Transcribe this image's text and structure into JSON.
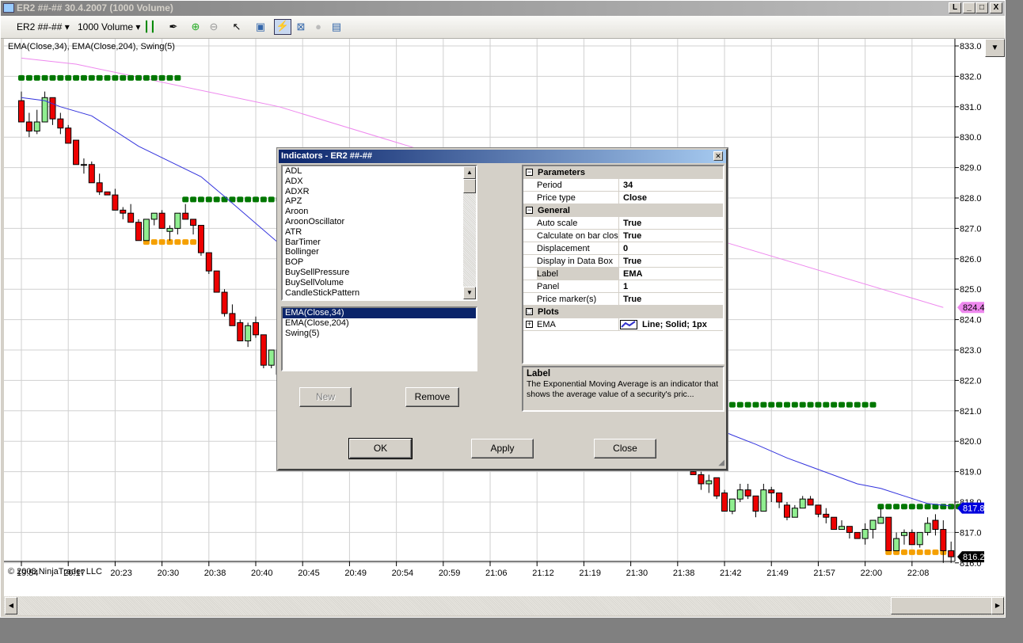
{
  "window": {
    "title": "ER2 ##-##  30.4.2007 (1000 Volume)",
    "buttons": [
      "L",
      "_",
      "□",
      "X"
    ]
  },
  "toolbar": {
    "instrument": "ER2 ##-##",
    "interval": "1000 Volume",
    "icons": [
      "bar-style-icon",
      "draw-pen-icon",
      "zoom-in-icon",
      "zoom-out-icon",
      "cursor-icon",
      "data-box-icon",
      "indicators-icon",
      "strategies-icon",
      "properties-icon",
      "table-icon"
    ]
  },
  "chart": {
    "indicator_label": "EMA(Close,34), EMA(Close,204), Swing(5)",
    "copyright": "© 2008 NinjaTrader  LLC",
    "colors": {
      "up": "#90ee90",
      "down": "#ee0000",
      "ema34": "#3333dd",
      "ema204": "#ee88ee",
      "swing_high": "#007700",
      "swing_low": "#f5a000"
    },
    "price_labels": [
      "833.0",
      "832.0",
      "831.0",
      "830.0",
      "829.0",
      "828.0",
      "827.0",
      "826.0",
      "825.0",
      "824.0",
      "823.0",
      "822.0",
      "821.0",
      "820.0",
      "819.0",
      "818.0",
      "817.0",
      "816.0"
    ],
    "ylim": [
      816,
      833
    ],
    "time_labels": [
      "19:54",
      "20:17",
      "20:23",
      "20:30",
      "20:38",
      "20:40",
      "20:45",
      "20:49",
      "20:54",
      "20:59",
      "21:06",
      "21:12",
      "21:19",
      "21:30",
      "21:38",
      "21:42",
      "21:49",
      "21:57",
      "22:00",
      "22:08"
    ],
    "bars_per_tick": 6,
    "candle_segments": [
      {
        "start": 0,
        "ohlc": [
          [
            831.2,
            831.5,
            830.5,
            830.5
          ],
          [
            830.5,
            830.8,
            830.0,
            830.2
          ],
          [
            830.2,
            830.9,
            830.1,
            830.5
          ],
          [
            830.5,
            831.5,
            830.5,
            831.3
          ],
          [
            831.3,
            831.3,
            830.4,
            830.6
          ],
          [
            830.6,
            830.8,
            830.1,
            830.3
          ],
          [
            830.3,
            830.4,
            829.8,
            829.8
          ],
          [
            829.9,
            829.9,
            829.1,
            829.1
          ],
          [
            829.1,
            829.3,
            828.8,
            829.1
          ],
          [
            829.1,
            829.2,
            828.5,
            828.5
          ],
          [
            828.5,
            828.8,
            828.1,
            828.2
          ],
          [
            828.2,
            828.2,
            828.1,
            828.1
          ],
          [
            828.1,
            828.3,
            827.6,
            827.6
          ],
          [
            827.6,
            827.7,
            827.3,
            827.5
          ],
          [
            827.5,
            827.8,
            827.2,
            827.2
          ],
          [
            827.2,
            827.3,
            826.6,
            826.6
          ],
          [
            826.6,
            827.3,
            826.6,
            827.3
          ],
          [
            827.3,
            827.5,
            827.1,
            827.5
          ],
          [
            827.5,
            827.6,
            827.0,
            827.0
          ],
          [
            826.9,
            827.1,
            826.6,
            827.0
          ],
          [
            827.0,
            827.5,
            826.8,
            827.5
          ],
          [
            827.5,
            827.8,
            827.3,
            827.3
          ],
          [
            827.3,
            827.3,
            826.8,
            827.1
          ],
          [
            827.1,
            827.1,
            826.1,
            826.2
          ],
          [
            826.2,
            826.2,
            825.5,
            825.6
          ],
          [
            825.6,
            825.6,
            824.9,
            824.9
          ],
          [
            824.9,
            825.0,
            824.1,
            824.2
          ],
          [
            824.2,
            824.5,
            823.8,
            823.8
          ],
          [
            823.9,
            824.0,
            823.3,
            823.3
          ],
          [
            823.3,
            823.9,
            823.1,
            823.8
          ],
          [
            823.9,
            824.1,
            823.4,
            823.5
          ],
          [
            823.5,
            823.5,
            822.4,
            822.5
          ],
          [
            822.5,
            823.0,
            822.4,
            823.0
          ],
          [
            823.0,
            823.0,
            822.2,
            822.2
          ]
        ]
      },
      {
        "start": 86,
        "ohlc": [
          [
            819.0,
            819.1,
            818.9,
            818.9
          ],
          [
            818.9,
            819.0,
            818.4,
            818.6
          ],
          [
            818.6,
            818.9,
            818.3,
            818.7
          ],
          [
            818.8,
            818.8,
            818.1,
            818.2
          ],
          [
            818.3,
            818.4,
            817.7,
            817.7
          ],
          [
            817.7,
            818.1,
            817.6,
            818.1
          ],
          [
            818.1,
            818.6,
            818.0,
            818.4
          ],
          [
            818.4,
            818.6,
            818.1,
            818.2
          ],
          [
            818.2,
            818.2,
            817.5,
            817.7
          ],
          [
            817.7,
            818.6,
            817.7,
            818.4
          ],
          [
            818.4,
            818.5,
            818.0,
            818.3
          ],
          [
            818.3,
            818.3,
            817.8,
            818.0
          ],
          [
            817.9,
            818.0,
            817.4,
            817.5
          ],
          [
            817.5,
            817.9,
            817.5,
            817.8
          ],
          [
            817.8,
            818.2,
            817.8,
            818.1
          ],
          [
            818.1,
            818.2,
            817.9,
            817.9
          ],
          [
            817.9,
            817.9,
            817.5,
            817.6
          ],
          [
            817.6,
            817.8,
            817.3,
            817.5
          ],
          [
            817.5,
            817.5,
            817.1,
            817.1
          ],
          [
            817.1,
            817.4,
            817.1,
            817.2
          ],
          [
            817.2,
            817.2,
            816.8,
            817.0
          ],
          [
            817.0,
            817.0,
            816.8,
            816.8
          ],
          [
            816.8,
            817.3,
            816.6,
            817.1
          ],
          [
            817.1,
            817.4,
            816.8,
            817.4
          ],
          [
            817.3,
            817.8,
            817.3,
            817.5
          ],
          [
            817.5,
            817.5,
            816.4,
            816.4
          ],
          [
            816.4,
            817.0,
            816.4,
            816.8
          ],
          [
            816.9,
            817.1,
            816.6,
            817.0
          ],
          [
            817.0,
            817.1,
            816.6,
            816.6
          ],
          [
            816.6,
            817.0,
            816.5,
            817.0
          ],
          [
            817.0,
            817.5,
            816.9,
            817.3
          ],
          [
            817.4,
            817.6,
            816.9,
            817.1
          ],
          [
            817.1,
            817.4,
            816.0,
            816.4
          ],
          [
            816.4,
            816.7,
            816.0,
            816.2
          ]
        ]
      }
    ],
    "ema34": [
      [
        0,
        831.3
      ],
      [
        3,
        831.2
      ],
      [
        5,
        831.0
      ],
      [
        9,
        830.7
      ],
      [
        15,
        829.7
      ],
      [
        19,
        829.2
      ],
      [
        23,
        828.7
      ],
      [
        26,
        828.05
      ],
      [
        33,
        826.5
      ],
      [
        91,
        820.2
      ],
      [
        94,
        819.9
      ],
      [
        98,
        819.45
      ],
      [
        107,
        818.6
      ],
      [
        110,
        818.45
      ],
      [
        116,
        817.95
      ],
      [
        119,
        817.87
      ]
    ],
    "ema204": [
      [
        0,
        832.6
      ],
      [
        7,
        832.4
      ],
      [
        33,
        831.0
      ],
      [
        90,
        826.55
      ],
      [
        118,
        824.4
      ]
    ],
    "swings": [
      {
        "kind": "high",
        "price": 831.95,
        "from": 0,
        "to": 20
      },
      {
        "kind": "high",
        "price": 827.95,
        "from": 21,
        "to": 33
      },
      {
        "kind": "high",
        "price": 821.2,
        "from": 90,
        "to": 109
      },
      {
        "kind": "high",
        "price": 817.85,
        "from": 110,
        "to": 120
      },
      {
        "kind": "low",
        "price": 826.55,
        "from": 16,
        "to": 22
      },
      {
        "kind": "low",
        "price": 816.35,
        "from": 111,
        "to": 118
      }
    ],
    "markers": [
      {
        "label": "824.4",
        "price": 824.4,
        "bg": "#ee88ee",
        "fg": "#000"
      },
      {
        "label": "817.8",
        "price": 817.8,
        "bg": "#0000dd",
        "fg": "#fff"
      },
      {
        "label": "816.2",
        "price": 816.2,
        "bg": "#000",
        "fg": "#fff"
      }
    ]
  },
  "dialog": {
    "title": "Indicators - ER2 ##-##",
    "available": [
      "ADL",
      "ADX",
      "ADXR",
      "APZ",
      "Aroon",
      "AroonOscillator",
      "ATR",
      "BarTimer",
      "Bollinger",
      "BOP",
      "BuySellPressure",
      "BuySellVolume",
      "CandleStickPattern"
    ],
    "applied": [
      "EMA(Close,34)",
      "EMA(Close,204)",
      "Swing(5)"
    ],
    "new_label": "New",
    "remove_label": "Remove",
    "ok_label": "OK",
    "apply_label": "Apply",
    "close_label": "Close",
    "categories": {
      "parameters": "Parameters",
      "general": "General",
      "plots": "Plots"
    },
    "parameters": [
      {
        "name": "Period",
        "value": "34"
      },
      {
        "name": "Price type",
        "value": "Close"
      }
    ],
    "general": [
      {
        "name": "Auto scale",
        "value": "True"
      },
      {
        "name": "Calculate on bar close",
        "value": "True"
      },
      {
        "name": "Displacement",
        "value": "0"
      },
      {
        "name": "Display in Data Box",
        "value": "True"
      },
      {
        "name": "Label",
        "value": "EMA"
      },
      {
        "name": "Panel",
        "value": "1"
      },
      {
        "name": "Price marker(s)",
        "value": "True"
      }
    ],
    "plots": [
      {
        "name": "EMA",
        "value": "Line; Solid; 1px"
      }
    ],
    "desc_title": "Label",
    "desc_text": "The Exponential Moving Average is an indicator that shows the average value of a security's pric..."
  }
}
